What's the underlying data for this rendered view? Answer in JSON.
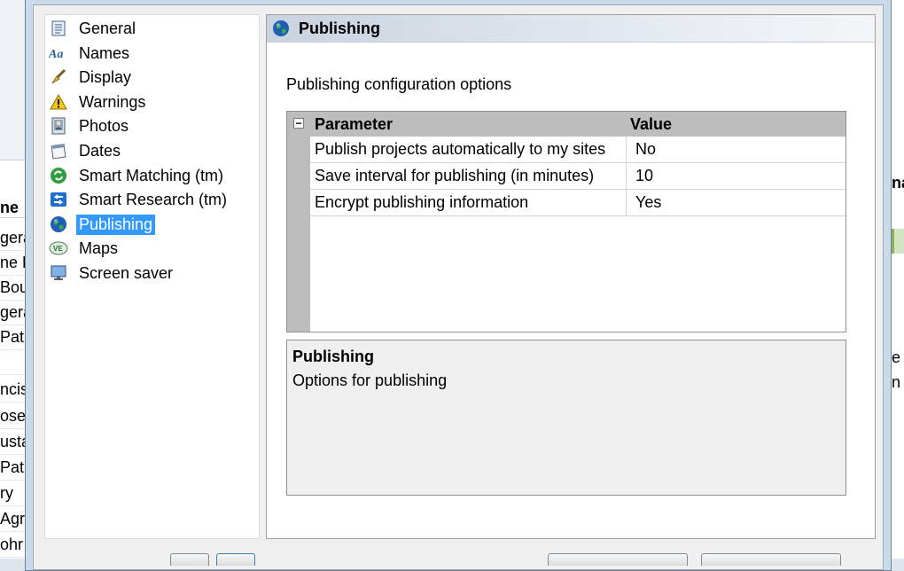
{
  "background_app": {
    "column_header": "ne",
    "rows": [
      "gera",
      "ne L",
      "Bou",
      "gera",
      "Patri",
      "",
      "ncis",
      "ose",
      "usta",
      "Patri",
      "ry",
      "Agr",
      "ohr"
    ],
    "right_texts": [
      "na",
      "e",
      "n"
    ]
  },
  "nav": {
    "items": [
      {
        "label": "General",
        "icon": "general-icon"
      },
      {
        "label": "Names",
        "icon": "names-icon"
      },
      {
        "label": "Display",
        "icon": "display-brush-icon"
      },
      {
        "label": "Warnings",
        "icon": "warning-icon"
      },
      {
        "label": "Photos",
        "icon": "photo-icon"
      },
      {
        "label": "Dates",
        "icon": "calendar-icon"
      },
      {
        "label": "Smart Matching (tm)",
        "icon": "smart-matching-icon"
      },
      {
        "label": "Smart Research (tm)",
        "icon": "smart-research-icon"
      },
      {
        "label": "Publishing",
        "icon": "globe-icon",
        "selected": true
      },
      {
        "label": "Maps",
        "icon": "map-icon"
      },
      {
        "label": "Screen saver",
        "icon": "monitor-icon"
      }
    ]
  },
  "panel": {
    "header_title": "Publishing",
    "description": "Publishing configuration options",
    "grid": {
      "columns": [
        "Parameter",
        "Value"
      ],
      "collapse_glyph": "−",
      "rows": [
        {
          "parameter": "Publish projects automatically to my sites",
          "value": "No"
        },
        {
          "parameter": "Save interval for publishing (in minutes)",
          "value": "10"
        },
        {
          "parameter": "Encrypt publishing information",
          "value": "Yes"
        }
      ]
    },
    "help": {
      "title": "Publishing",
      "text": "Options for publishing"
    }
  },
  "colors": {
    "selection": "#3399ff",
    "grid_header": "#bdbdbd",
    "dialog_frame": "#c9daea"
  }
}
